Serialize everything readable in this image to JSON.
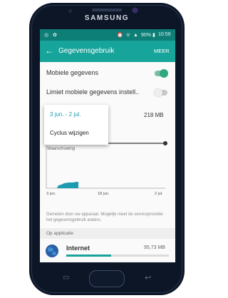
{
  "device": {
    "brand": "SAMSUNG"
  },
  "statusbar": {
    "left_icons": "◎ ✿",
    "right_icons": "⏰ ᯤ ▲",
    "battery": "90% ▮",
    "time": "10:59"
  },
  "appbar": {
    "back_icon": "←",
    "title": "Gegevensgebruik",
    "more": "MEER"
  },
  "settings": {
    "mobile_data": {
      "label": "Mobiele gegevens",
      "enabled": true
    },
    "limit": {
      "label": "Limiet mobiele gegevens instell..",
      "enabled": false
    }
  },
  "usage_total": "218 MB",
  "chart_data": {
    "type": "area",
    "x_ticks": [
      "3 jun.",
      "18 jun.",
      "2 jul."
    ],
    "warning_label": "Waarschuwing"
  },
  "note": "Gemeten door uw apparaat. Mogelijk meet de serviceprovider het gegevensgebruik anders.",
  "section_header": "Op applicatie",
  "apps": [
    {
      "name": "Internet",
      "usage": "95,73 MB",
      "fraction": 0.44
    }
  ],
  "popup": {
    "options": [
      "3 jun. - 2 jul.",
      "Cyclus wijzigen"
    ]
  },
  "nav": {
    "recent_icon": "▭",
    "back_icon": "↩"
  }
}
